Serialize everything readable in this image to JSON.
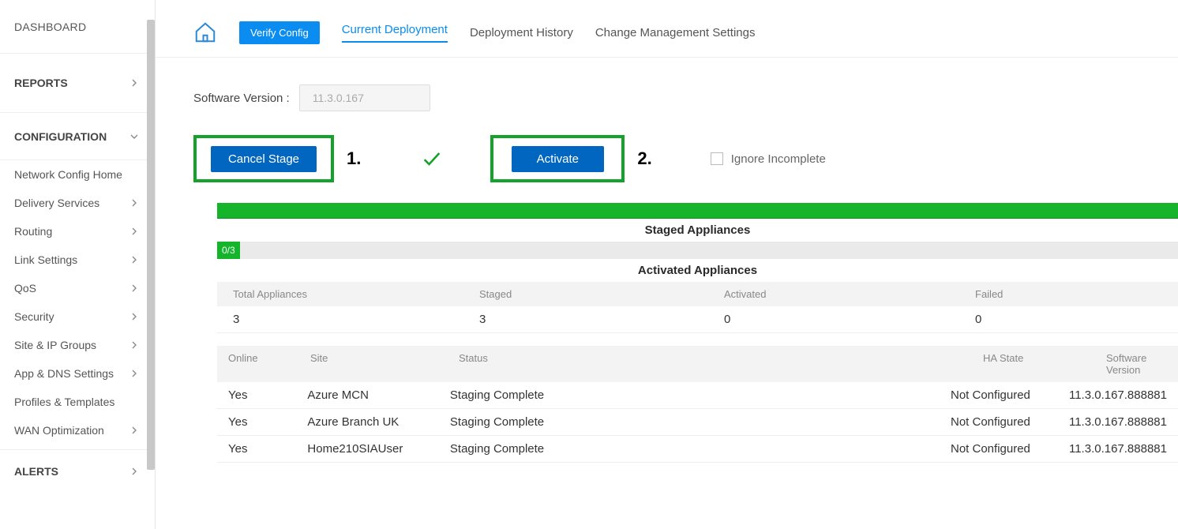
{
  "sidebar": {
    "dashboard": "Dashboard",
    "reports": "Reports",
    "configuration": "Configuration",
    "items": [
      "Network Config Home",
      "Delivery Services",
      "Routing",
      "Link Settings",
      "QoS",
      "Security",
      "Site & IP Groups",
      "App & DNS Settings",
      "Profiles & Templates",
      "WAN Optimization"
    ],
    "alerts": "Alerts"
  },
  "tabs": {
    "verify": "Verify Config",
    "current": "Current Deployment",
    "history": "Deployment History",
    "settings": "Change Management Settings"
  },
  "software": {
    "label": "Software Version :",
    "value": "11.3.0.167"
  },
  "actions": {
    "cancel": "Cancel Stage",
    "activate": "Activate",
    "ignore": "Ignore Incomplete",
    "annot1": "1.",
    "annot2": "2."
  },
  "sections": {
    "staged": "Staged Appliances",
    "activated": "Activated Appliances",
    "badge": "0/3"
  },
  "stats": {
    "headers": {
      "total": "Total Appliances",
      "staged": "Staged",
      "activated": "Activated",
      "failed": "Failed"
    },
    "values": {
      "total": "3",
      "staged": "3",
      "activated": "0",
      "failed": "0"
    }
  },
  "table": {
    "headers": {
      "online": "Online",
      "site": "Site",
      "status": "Status",
      "ha": "HA State",
      "sv": "Software Version"
    },
    "rows": [
      {
        "online": "Yes",
        "site": "Azure MCN",
        "status": "Staging Complete",
        "ha": "Not Configured",
        "sv": "11.3.0.167.888881"
      },
      {
        "online": "Yes",
        "site": "Azure Branch UK",
        "status": "Staging Complete",
        "ha": "Not Configured",
        "sv": "11.3.0.167.888881"
      },
      {
        "online": "Yes",
        "site": "Home210SIAUser",
        "status": "Staging Complete",
        "ha": "Not Configured",
        "sv": "11.3.0.167.888881"
      }
    ]
  }
}
